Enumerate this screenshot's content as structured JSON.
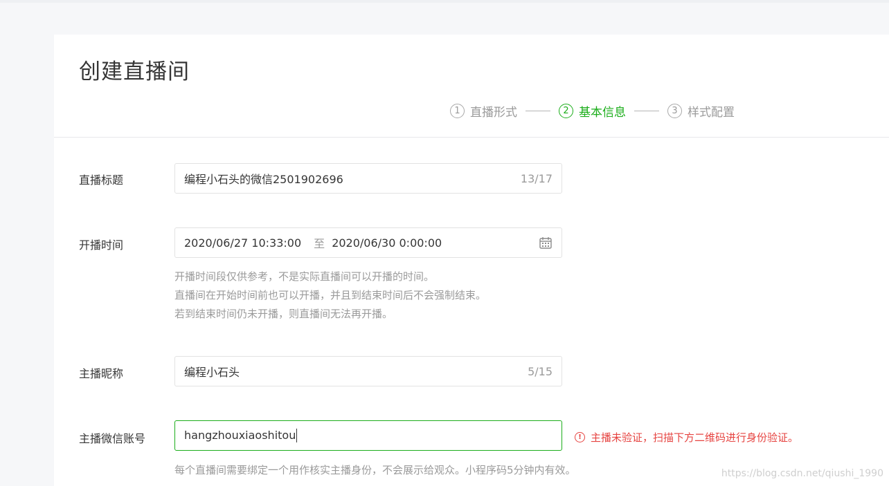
{
  "page_title": "创建直播间",
  "steps": [
    {
      "num": "1",
      "label": "直播形式"
    },
    {
      "num": "2",
      "label": "基本信息"
    },
    {
      "num": "3",
      "label": "样式配置"
    }
  ],
  "active_step": 2,
  "form": {
    "title": {
      "label": "直播标题",
      "value": "编程小石头的微信2501902696",
      "counter": "13/17"
    },
    "time": {
      "label": "开播时间",
      "start": "2020/06/27 10:33:00",
      "separator": "至",
      "end": "2020/06/30 0:00:00",
      "icon": "calendar-icon",
      "hints": [
        "开播时间段仅供参考，不是实际直播间可以开播的时间。",
        "直播间在开始时间前也可以开播，并且到结束时间后不会强制结束。",
        "若到结束时间仍未开播，则直播间无法再开播。"
      ]
    },
    "nickname": {
      "label": "主播昵称",
      "value": "编程小石头",
      "counter": "5/15"
    },
    "wechat": {
      "label": "主播微信账号",
      "value": "hangzhouxiaoshitou",
      "error": "主播未验证，扫描下方二维码进行身份验证。",
      "error_icon": "alert-circle-icon",
      "hint": "每个直播间需要绑定一个用作核实主播身份，不会展示给观众。小程序码5分钟内有效。"
    }
  },
  "watermark": "https://blog.csdn.net/qiushi_1990",
  "colors": {
    "accent": "#1aad19",
    "error": "#e64340",
    "muted": "#9a9a9a",
    "text": "#353535"
  }
}
